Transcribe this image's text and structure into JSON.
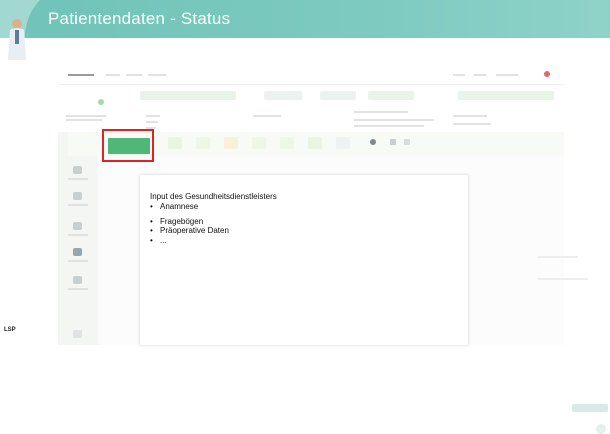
{
  "slide": {
    "title": "Patientendaten - Status"
  },
  "panel": {
    "heading": "Input des Gesundheitsdienstleisters",
    "items": [
      "Anamnese",
      "Fragebögen",
      "Präoperative Daten",
      "..."
    ],
    "bullet": "•"
  },
  "footer": {
    "logo_text": "LSP"
  },
  "colors": {
    "header": "#7dcac0",
    "highlight_box": "#e02424",
    "active_tab": "#4fb878"
  }
}
